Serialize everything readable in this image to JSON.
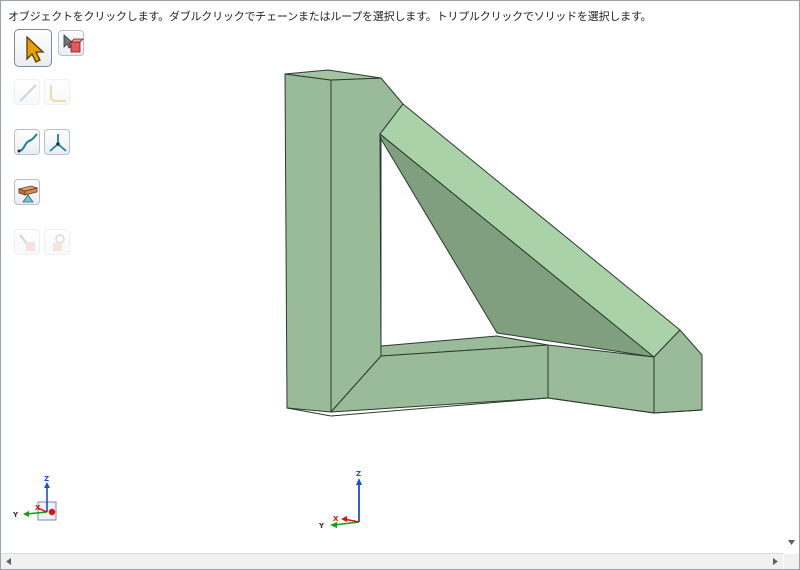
{
  "status_hint": "オブジェクトをクリックします。ダブルクリックでチェーンまたはループを選択します。トリプルクリックでソリッドを選択します。",
  "toolbar": {
    "tools": [
      {
        "name": "select-arrow-tool",
        "icon": "select-arrow-icon",
        "enabled": true,
        "active": true
      },
      {
        "name": "select-solid-tool",
        "icon": "select-solid-icon",
        "enabled": true
      },
      {
        "name": "edge-curve-tool",
        "icon": "edge-curve-icon",
        "enabled": false
      },
      {
        "name": "bent-curve-tool",
        "icon": "bent-curve-icon",
        "enabled": false
      },
      {
        "name": "sketch-curve-tool",
        "icon": "sketch-curve-icon",
        "enabled": true
      },
      {
        "name": "fork-curve-tool",
        "icon": "fork-curve-icon",
        "enabled": true
      },
      {
        "name": "beam-profile-tool",
        "icon": "beam-profile-icon",
        "enabled": true
      },
      {
        "name": "part-a-tool",
        "icon": "part-a-icon",
        "enabled": false
      },
      {
        "name": "part-b-tool",
        "icon": "part-b-icon",
        "enabled": false
      }
    ]
  },
  "model": {
    "name": "triangular-bracket",
    "face_color_light": "#a9d2a9",
    "face_color_mid": "#99bb99",
    "face_color_dark": "#7f9f7f",
    "edge_color": "#2d3a2d"
  },
  "triad_left": {
    "x_label": "X",
    "y_label": "Y",
    "z_label": "Z"
  },
  "triad_center": {
    "x_label": "X",
    "y_label": "Y",
    "z_label": "Z"
  },
  "colors": {
    "x_axis": "#e01010",
    "y_axis": "#10a010",
    "z_axis": "#1a4fd0"
  }
}
